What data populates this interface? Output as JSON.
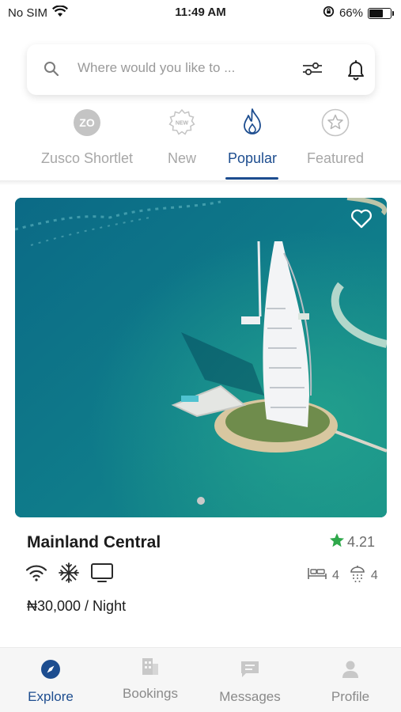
{
  "status_bar": {
    "carrier": "No SIM",
    "time": "11:49 AM",
    "battery_percent": "66%",
    "battery_level": 0.66
  },
  "search": {
    "placeholder": "Where would you like to ..."
  },
  "categories": [
    {
      "label": "Zusco Shortlet",
      "icon": "zusco-logo-icon",
      "active": false
    },
    {
      "label": "New",
      "icon": "new-badge-icon",
      "active": false
    },
    {
      "label": "Popular",
      "icon": "flame-icon",
      "active": true
    },
    {
      "label": "Featured",
      "icon": "star-circle-icon",
      "active": false
    }
  ],
  "listing": {
    "title": "Mainland Central",
    "rating": "4.21",
    "amenities": [
      "wifi-icon",
      "snowflake-icon",
      "tv-icon"
    ],
    "bedrooms": "4",
    "bathrooms": "4",
    "price": "₦30,000 / Night",
    "image_count": 1,
    "current_image": 1
  },
  "nav": [
    {
      "label": "Explore",
      "icon": "compass-icon",
      "active": true
    },
    {
      "label": "Bookings",
      "icon": "building-icon",
      "active": false
    },
    {
      "label": "Messages",
      "icon": "chat-icon",
      "active": false
    },
    {
      "label": "Profile",
      "icon": "person-icon",
      "active": false
    }
  ],
  "colors": {
    "accent": "#1d4d8f",
    "rating_star": "#2ea84a",
    "inactive": "#a7a7a7"
  }
}
